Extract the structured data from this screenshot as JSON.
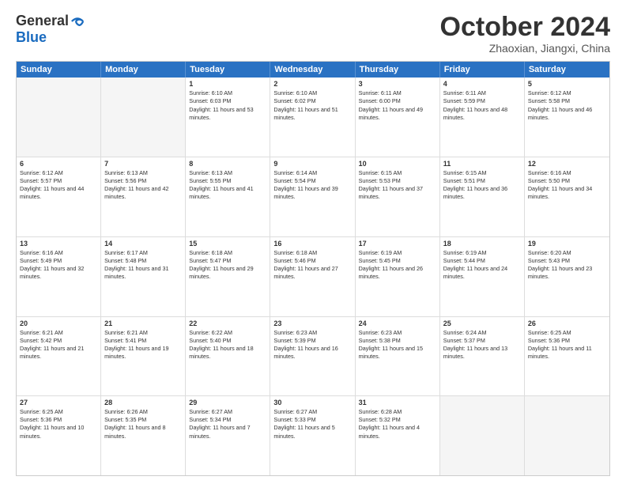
{
  "header": {
    "logo_general": "General",
    "logo_blue": "Blue",
    "month": "October 2024",
    "location": "Zhaoxian, Jiangxi, China"
  },
  "days_of_week": [
    "Sunday",
    "Monday",
    "Tuesday",
    "Wednesday",
    "Thursday",
    "Friday",
    "Saturday"
  ],
  "rows": [
    [
      {
        "day": "",
        "empty": true
      },
      {
        "day": "",
        "empty": true
      },
      {
        "day": "1",
        "sunrise": "Sunrise: 6:10 AM",
        "sunset": "Sunset: 6:03 PM",
        "daylight": "Daylight: 11 hours and 53 minutes."
      },
      {
        "day": "2",
        "sunrise": "Sunrise: 6:10 AM",
        "sunset": "Sunset: 6:02 PM",
        "daylight": "Daylight: 11 hours and 51 minutes."
      },
      {
        "day": "3",
        "sunrise": "Sunrise: 6:11 AM",
        "sunset": "Sunset: 6:00 PM",
        "daylight": "Daylight: 11 hours and 49 minutes."
      },
      {
        "day": "4",
        "sunrise": "Sunrise: 6:11 AM",
        "sunset": "Sunset: 5:59 PM",
        "daylight": "Daylight: 11 hours and 48 minutes."
      },
      {
        "day": "5",
        "sunrise": "Sunrise: 6:12 AM",
        "sunset": "Sunset: 5:58 PM",
        "daylight": "Daylight: 11 hours and 46 minutes."
      }
    ],
    [
      {
        "day": "6",
        "sunrise": "Sunrise: 6:12 AM",
        "sunset": "Sunset: 5:57 PM",
        "daylight": "Daylight: 11 hours and 44 minutes."
      },
      {
        "day": "7",
        "sunrise": "Sunrise: 6:13 AM",
        "sunset": "Sunset: 5:56 PM",
        "daylight": "Daylight: 11 hours and 42 minutes."
      },
      {
        "day": "8",
        "sunrise": "Sunrise: 6:13 AM",
        "sunset": "Sunset: 5:55 PM",
        "daylight": "Daylight: 11 hours and 41 minutes."
      },
      {
        "day": "9",
        "sunrise": "Sunrise: 6:14 AM",
        "sunset": "Sunset: 5:54 PM",
        "daylight": "Daylight: 11 hours and 39 minutes."
      },
      {
        "day": "10",
        "sunrise": "Sunrise: 6:15 AM",
        "sunset": "Sunset: 5:53 PM",
        "daylight": "Daylight: 11 hours and 37 minutes."
      },
      {
        "day": "11",
        "sunrise": "Sunrise: 6:15 AM",
        "sunset": "Sunset: 5:51 PM",
        "daylight": "Daylight: 11 hours and 36 minutes."
      },
      {
        "day": "12",
        "sunrise": "Sunrise: 6:16 AM",
        "sunset": "Sunset: 5:50 PM",
        "daylight": "Daylight: 11 hours and 34 minutes."
      }
    ],
    [
      {
        "day": "13",
        "sunrise": "Sunrise: 6:16 AM",
        "sunset": "Sunset: 5:49 PM",
        "daylight": "Daylight: 11 hours and 32 minutes."
      },
      {
        "day": "14",
        "sunrise": "Sunrise: 6:17 AM",
        "sunset": "Sunset: 5:48 PM",
        "daylight": "Daylight: 11 hours and 31 minutes."
      },
      {
        "day": "15",
        "sunrise": "Sunrise: 6:18 AM",
        "sunset": "Sunset: 5:47 PM",
        "daylight": "Daylight: 11 hours and 29 minutes."
      },
      {
        "day": "16",
        "sunrise": "Sunrise: 6:18 AM",
        "sunset": "Sunset: 5:46 PM",
        "daylight": "Daylight: 11 hours and 27 minutes."
      },
      {
        "day": "17",
        "sunrise": "Sunrise: 6:19 AM",
        "sunset": "Sunset: 5:45 PM",
        "daylight": "Daylight: 11 hours and 26 minutes."
      },
      {
        "day": "18",
        "sunrise": "Sunrise: 6:19 AM",
        "sunset": "Sunset: 5:44 PM",
        "daylight": "Daylight: 11 hours and 24 minutes."
      },
      {
        "day": "19",
        "sunrise": "Sunrise: 6:20 AM",
        "sunset": "Sunset: 5:43 PM",
        "daylight": "Daylight: 11 hours and 23 minutes."
      }
    ],
    [
      {
        "day": "20",
        "sunrise": "Sunrise: 6:21 AM",
        "sunset": "Sunset: 5:42 PM",
        "daylight": "Daylight: 11 hours and 21 minutes."
      },
      {
        "day": "21",
        "sunrise": "Sunrise: 6:21 AM",
        "sunset": "Sunset: 5:41 PM",
        "daylight": "Daylight: 11 hours and 19 minutes."
      },
      {
        "day": "22",
        "sunrise": "Sunrise: 6:22 AM",
        "sunset": "Sunset: 5:40 PM",
        "daylight": "Daylight: 11 hours and 18 minutes."
      },
      {
        "day": "23",
        "sunrise": "Sunrise: 6:23 AM",
        "sunset": "Sunset: 5:39 PM",
        "daylight": "Daylight: 11 hours and 16 minutes."
      },
      {
        "day": "24",
        "sunrise": "Sunrise: 6:23 AM",
        "sunset": "Sunset: 5:38 PM",
        "daylight": "Daylight: 11 hours and 15 minutes."
      },
      {
        "day": "25",
        "sunrise": "Sunrise: 6:24 AM",
        "sunset": "Sunset: 5:37 PM",
        "daylight": "Daylight: 11 hours and 13 minutes."
      },
      {
        "day": "26",
        "sunrise": "Sunrise: 6:25 AM",
        "sunset": "Sunset: 5:36 PM",
        "daylight": "Daylight: 11 hours and 11 minutes."
      }
    ],
    [
      {
        "day": "27",
        "sunrise": "Sunrise: 6:25 AM",
        "sunset": "Sunset: 5:36 PM",
        "daylight": "Daylight: 11 hours and 10 minutes."
      },
      {
        "day": "28",
        "sunrise": "Sunrise: 6:26 AM",
        "sunset": "Sunset: 5:35 PM",
        "daylight": "Daylight: 11 hours and 8 minutes."
      },
      {
        "day": "29",
        "sunrise": "Sunrise: 6:27 AM",
        "sunset": "Sunset: 5:34 PM",
        "daylight": "Daylight: 11 hours and 7 minutes."
      },
      {
        "day": "30",
        "sunrise": "Sunrise: 6:27 AM",
        "sunset": "Sunset: 5:33 PM",
        "daylight": "Daylight: 11 hours and 5 minutes."
      },
      {
        "day": "31",
        "sunrise": "Sunrise: 6:28 AM",
        "sunset": "Sunset: 5:32 PM",
        "daylight": "Daylight: 11 hours and 4 minutes."
      },
      {
        "day": "",
        "empty": true
      },
      {
        "day": "",
        "empty": true
      }
    ]
  ]
}
